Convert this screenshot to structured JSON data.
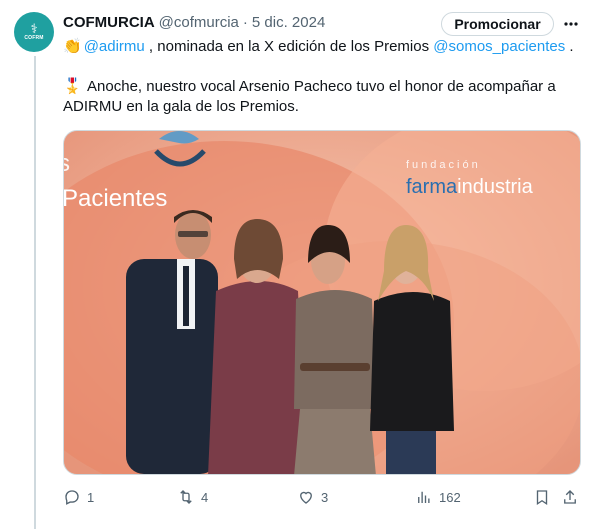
{
  "tweet": {
    "display_name": "COFMURCIA",
    "handle": "@cofmurcia",
    "separator": "·",
    "date": "5 dic. 2024",
    "promote_label": "Promocionar",
    "avatar_text": "COFRM",
    "line1": {
      "emoji": "👏",
      "mention": "@adirmu",
      "middle": " , nominada en la X edición de los Premios ",
      "mention2": "@somos_pacientes",
      "end": " ."
    },
    "line2": {
      "emoji": "🎖️",
      "text": "Anoche, nuestro vocal Arsenio Pacheco tuvo el honor de acompañar a ADIRMU en la gala de los Premios."
    }
  },
  "media": {
    "backdrop_left_text": "Pacientes",
    "backdrop_left_partial": "s",
    "backdrop_right_small": "fundación",
    "backdrop_right_brand1": "farma",
    "backdrop_right_brand2": "industria"
  },
  "actions": {
    "replies": "1",
    "reposts": "4",
    "likes": "3",
    "views": "162"
  },
  "colors": {
    "accent": "#1d9bf0",
    "muted": "#536471",
    "avatar": "#1fa0a0",
    "backdrop": "#f3b79c"
  },
  "icons": [
    "avatar-logo",
    "more-icon",
    "reply-icon",
    "repost-icon",
    "like-icon",
    "views-icon",
    "bookmark-icon",
    "share-icon"
  ]
}
